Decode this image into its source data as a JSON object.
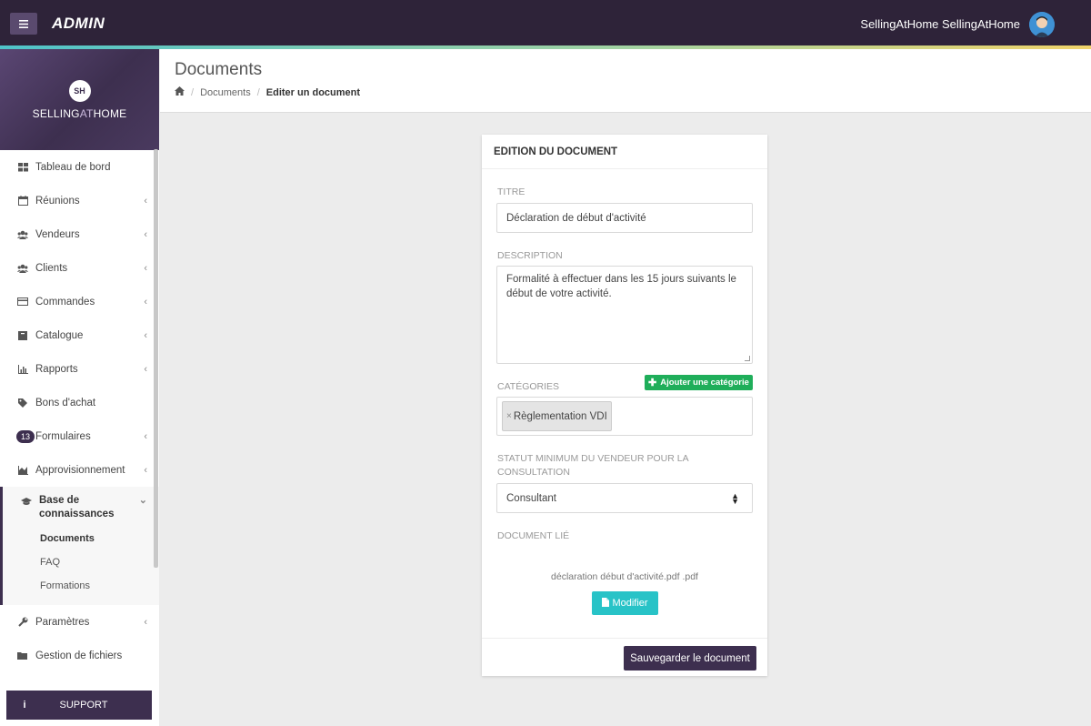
{
  "topbar": {
    "brand": "ADMIN",
    "user_name": "SellingAtHome SellingAtHome",
    "accent_colors": [
      "#2e2339",
      "#4fc3c9",
      "#f0d36a"
    ]
  },
  "sidebar": {
    "logo_initials": "SH",
    "logo_text_1": "SELLING",
    "logo_text_at": "AT",
    "logo_text_2": "HOME",
    "items": [
      {
        "label": "Tableau de bord",
        "icon": "dashboard-icon",
        "chevron": false
      },
      {
        "label": "Réunions",
        "icon": "calendar-icon",
        "chevron": true
      },
      {
        "label": "Vendeurs",
        "icon": "users-icon",
        "chevron": true
      },
      {
        "label": "Clients",
        "icon": "users-icon",
        "chevron": true
      },
      {
        "label": "Commandes",
        "icon": "credit-card-icon",
        "chevron": true
      },
      {
        "label": "Catalogue",
        "icon": "book-icon",
        "chevron": true
      },
      {
        "label": "Rapports",
        "icon": "bar-chart-icon",
        "chevron": true
      },
      {
        "label": "Bons d'achat",
        "icon": "tag-icon",
        "chevron": false
      },
      {
        "label": "Formulaires",
        "icon": "badge",
        "badge": "13",
        "chevron": true
      },
      {
        "label": "Approvisionnement",
        "icon": "area-chart-icon",
        "chevron": true
      }
    ],
    "active_group": {
      "label": "Base de connaissances",
      "icon": "graduation-cap-icon",
      "subitems": [
        "Documents",
        "FAQ",
        "Formations"
      ]
    },
    "bottom_items": [
      {
        "label": "Paramètres",
        "icon": "wrench-icon",
        "chevron": true
      },
      {
        "label": "Gestion de fichiers",
        "icon": "folder-icon",
        "chevron": false
      }
    ],
    "support": "SUPPORT"
  },
  "header": {
    "title": "Documents",
    "breadcrumb": [
      "Documents",
      "Editer un document"
    ]
  },
  "form": {
    "card_title": "EDITION DU DOCUMENT",
    "title_label": "TITRE",
    "title_value": "Déclaration de début d'activité",
    "description_label": "DESCRIPTION",
    "description_value": "Formalité à effectuer dans les 15 jours suivants le début de votre activité.",
    "categories_label": "CATÉGORIES",
    "add_category": "Ajouter une catégorie",
    "category_tag": "Règlementation VDI",
    "status_label": "STATUT MINIMUM DU VENDEUR POUR LA CONSULTATION",
    "status_value": "Consultant",
    "document_label": "DOCUMENT LIÉ",
    "file_name": "déclaration début d'activité.pdf .pdf",
    "modify": "Modifier",
    "save": "Sauvegarder le document"
  }
}
